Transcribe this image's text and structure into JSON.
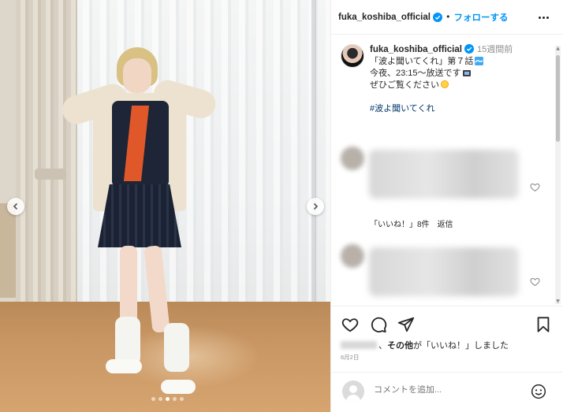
{
  "header": {
    "username": "fuka_koshiba_official",
    "separator": "•",
    "follow_label": "フォローする"
  },
  "caption": {
    "username": "fuka_koshiba_official",
    "time": "15週間前",
    "lines": [
      "「波よ聞いてくれ」第７話",
      "今夜、23:15〜放送です",
      "ぜひご覧ください"
    ],
    "hashtag": "#波よ聞いてくれ"
  },
  "comments": [
    {
      "meta_likes": "「いいね！」8件",
      "meta_reply": "返信"
    }
  ],
  "likes": {
    "text_bold": "その他",
    "text": "が「いいね！」しました",
    "prefix": "、"
  },
  "date": "6月2日",
  "comment_bar": {
    "placeholder": "コメントを追加..."
  },
  "carousel": {
    "total": 5,
    "active": 3
  },
  "icons": {
    "verified": "verified-badge-icon",
    "more": "more-options-icon",
    "heart": "heart-icon",
    "comment": "comment-icon",
    "share": "share-icon",
    "bookmark": "bookmark-icon",
    "emoji": "emoji-icon"
  },
  "colors": {
    "accent": "#0095f6",
    "verified": "#0095f6",
    "hashtag": "#00376b",
    "muted": "#8e8e8e"
  }
}
